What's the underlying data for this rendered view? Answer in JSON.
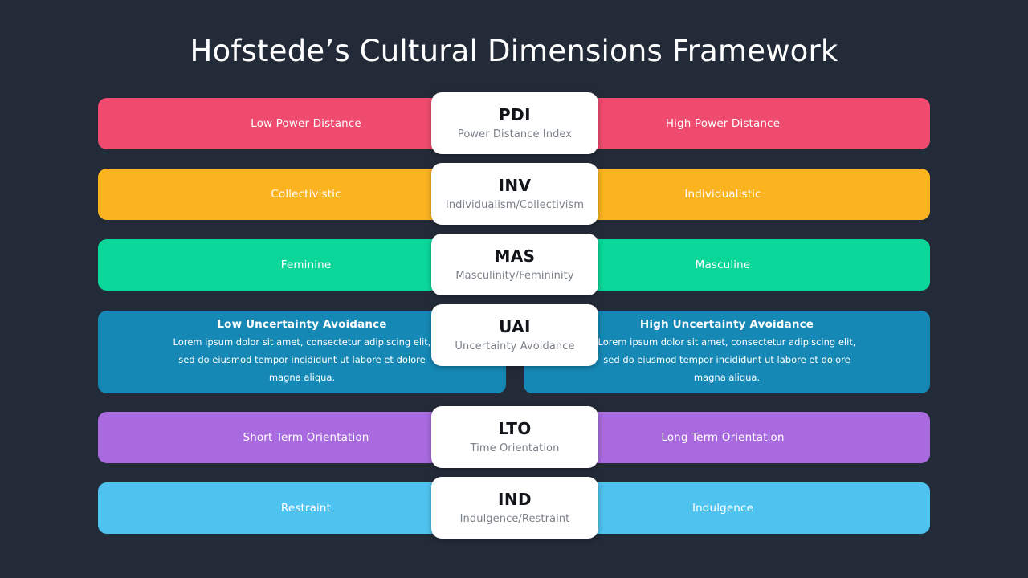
{
  "slide": {
    "title": "Hofstede’s Cultural Dimensions Framework",
    "background_color": "#242b38",
    "title_color": "#ffffff"
  },
  "rows": [
    {
      "code": "PDI",
      "name": "Power Distance Index",
      "color": "#ef4b6e",
      "left": {
        "heading": "Low Power Distance",
        "body": ""
      },
      "right": {
        "heading": "High Power Distance",
        "body": ""
      }
    },
    {
      "code": "INV",
      "name": "Individualism/Collectivism",
      "color": "#fbb320",
      "left": {
        "heading": "Collectivistic",
        "body": ""
      },
      "right": {
        "heading": "Individualistic",
        "body": ""
      }
    },
    {
      "code": "MAS",
      "name": "Masculinity/Femininity",
      "color": "#0bd79b",
      "left": {
        "heading": "Feminine",
        "body": ""
      },
      "right": {
        "heading": "Masculine",
        "body": ""
      }
    },
    {
      "code": "UAI",
      "name": "Uncertainty Avoidance",
      "color": "#1588b5",
      "left": {
        "heading": "Low Uncertainty Avoidance",
        "body": "Lorem ipsum dolor  sit amet, consectetur adipiscing elit, sed do eiusmod tempor incididunt ut labore et dolore magna aliqua."
      },
      "right": {
        "heading": "High Uncertainty Avoidance",
        "body": "Lorem ipsum dolor  sit amet, consectetur adipiscing elit, sed do eiusmod tempor incididunt ut labore et dolore magna aliqua."
      }
    },
    {
      "code": "LTO",
      "name": "Time Orientation",
      "color": "#a86ade",
      "left": {
        "heading": "Short Term Orientation",
        "body": ""
      },
      "right": {
        "heading": "Long Term Orientation",
        "body": ""
      }
    },
    {
      "code": "IND",
      "name": "Indulgence/Restraint",
      "color": "#4fc3ef",
      "left": {
        "heading": "Restraint",
        "body": ""
      },
      "right": {
        "heading": "Indulgence",
        "body": ""
      }
    }
  ]
}
